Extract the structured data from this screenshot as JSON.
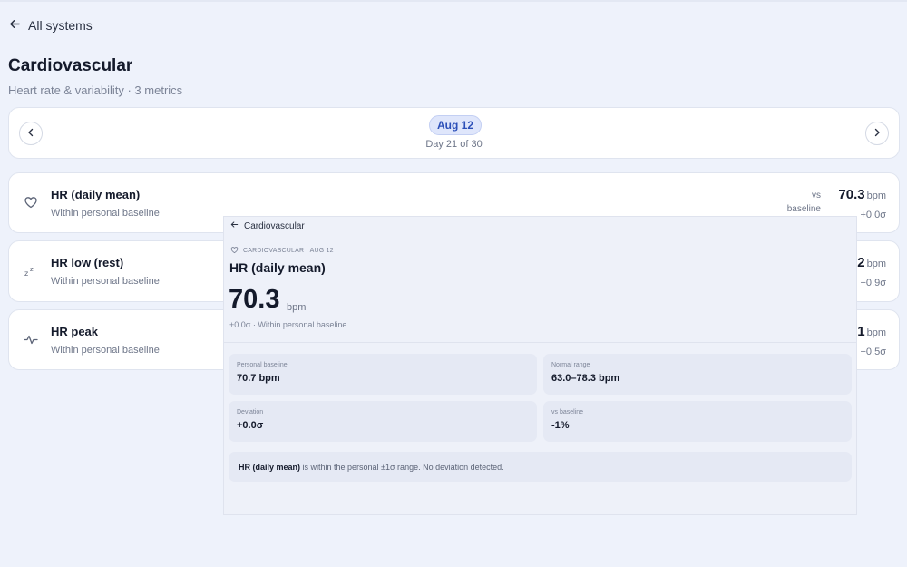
{
  "nav": {
    "back_label": "All systems"
  },
  "header": {
    "title": "Cardiovascular",
    "subtitle": "Heart rate & variability · 3 metrics"
  },
  "date_nav": {
    "date": "Aug 12",
    "day_label": "Day 21 of 30"
  },
  "metrics": [
    {
      "name": "HR (daily mean)",
      "status": "Within personal baseline",
      "value": "70.3",
      "unit": "bpm",
      "sigma": "+0.0σ",
      "vs_line1": "vs",
      "vs_line2": "baseline",
      "icon": "heart-icon"
    },
    {
      "name": "HR low (rest)",
      "status": "Within personal baseline",
      "value_visible": "2",
      "unit": "bpm",
      "sigma": "−0.9σ",
      "icon": "sleep-icon"
    },
    {
      "name": "HR peak",
      "status": "Within personal baseline",
      "value_visible": "1",
      "unit": "bpm",
      "sigma": "−0.5σ",
      "icon": "pulse-icon"
    }
  ],
  "detail": {
    "back_label": "Cardiovascular",
    "tag": "CARDIOVASCULAR · AUG 12",
    "title": "HR (daily mean)",
    "value": "70.3",
    "unit": "bpm",
    "note": "+0.0σ · Within personal baseline",
    "stats": [
      {
        "label": "Personal baseline",
        "value": "70.7 bpm"
      },
      {
        "label": "Normal range",
        "value": "63.0–78.3 bpm"
      },
      {
        "label": "Deviation",
        "value": "+0.0σ"
      },
      {
        "label": "vs baseline",
        "value": "-1%"
      }
    ],
    "message_metric": "HR (daily mean)",
    "message_text": " is within the personal ±1σ range. No deviation detected."
  }
}
